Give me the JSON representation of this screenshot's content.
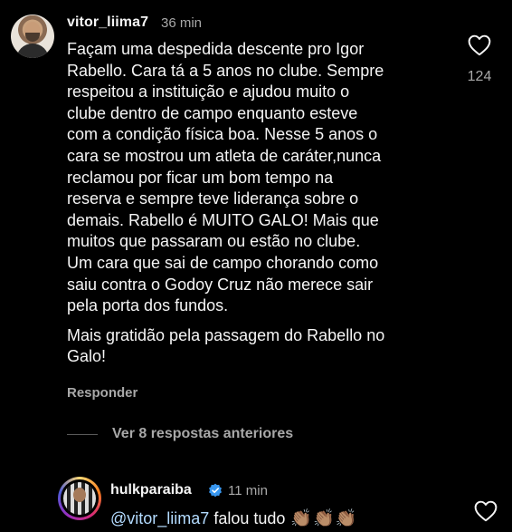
{
  "comment": {
    "username": "vitor_liima7",
    "time": "36 min",
    "paragraphs": [
      "Façam uma despedida descente pro Igor\nRabello. Cara tá a 5 anos no clube. Sempre\nrespeitou a instituição e ajudou muito o\nclube dentro de campo enquanto esteve\ncom a condição física boa. Nesse 5 anos o\ncara se mostrou um atleta de caráter,nunca\nreclamou por ficar um bom tempo na\nreserva e sempre teve liderança sobre o\ndemais. Rabello é MUITO GALO! Mais que\nmuitos que passaram ou estão no clube.\nUm cara que sai de campo chorando como\nsaiu contra o Godoy Cruz não merece sair\npela porta dos fundos.",
      "Mais gratidão pela passagem do Rabello no\nGalo!"
    ],
    "reply_label": "Responder",
    "like_count": "124",
    "like_icon": "heart-outline-icon"
  },
  "view_replies_label": "Ver 8 respostas anteriores",
  "reply": {
    "username": "hulkparaiba",
    "verified_icon": "verified-badge-icon",
    "time": "11 min",
    "mention": "@vitor_liima7",
    "text": " falou tudo ",
    "emoji": [
      "👏🏽",
      "👏🏽",
      "👏🏽"
    ],
    "like_icon": "heart-outline-icon"
  },
  "colors": {
    "background": "#000000",
    "primary_text": "#f5f5f5",
    "secondary_text": "#a8a8a8",
    "mention": "#b3dbff",
    "verified": "#3897f0"
  }
}
